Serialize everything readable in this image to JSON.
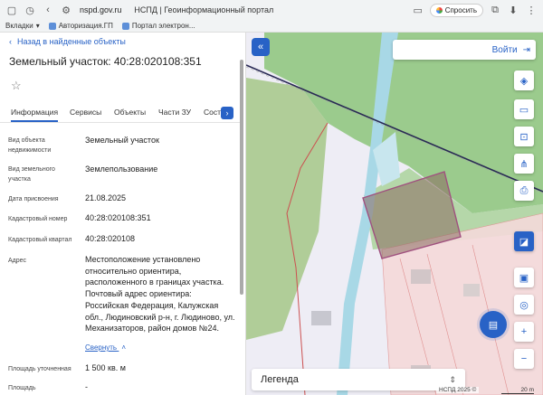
{
  "browser": {
    "url": "nspd.gov.ru",
    "tab_title": "НСПД | Геоинформационный портал",
    "ask_label": "Спросить",
    "bookmarks_label": "Вкладки",
    "bookmark_items": [
      "Авторизация.ГП",
      "Портал электрон..."
    ]
  },
  "panel": {
    "back_label": "Назад в найденные объекты",
    "title": "Земельный участок: 40:28:020108:351",
    "tabs": [
      "Информация",
      "Сервисы",
      "Объекты",
      "Части ЗУ",
      "Состав"
    ],
    "properties": [
      {
        "label": "Вид объекта недвижимости",
        "value": "Земельный участок"
      },
      {
        "label": "Вид земельного участка",
        "value": "Землепользование"
      },
      {
        "label": "Дата присвоения",
        "value": "21.08.2025"
      },
      {
        "label": "Кадастровый номер",
        "value": "40:28:020108:351"
      },
      {
        "label": "Кадастровый квартал",
        "value": "40:28:020108"
      },
      {
        "label": "Адрес",
        "value": "Местоположение установлено относительно ориентира, расположенного в границах участка. Почтовый адрес ориентира: Российская Федерация, Калужская обл., Людиновский р-н, г. Людиново, ул. Механизаторов, район домов №24."
      },
      {
        "label": "Площадь уточненная",
        "value": "1 500 кв. м"
      },
      {
        "label": "Площадь",
        "value": "-"
      }
    ],
    "collapse_label": "Свернуть"
  },
  "map": {
    "login_label": "Войти",
    "legend_label": "Легенда",
    "attribution": "НСПД 2025 ©",
    "scale_label": "20 m",
    "colors": {
      "accent": "#2862c6",
      "forest": "#8cc47a",
      "parcel": "#a0507f",
      "water": "#a8d8e6"
    }
  }
}
